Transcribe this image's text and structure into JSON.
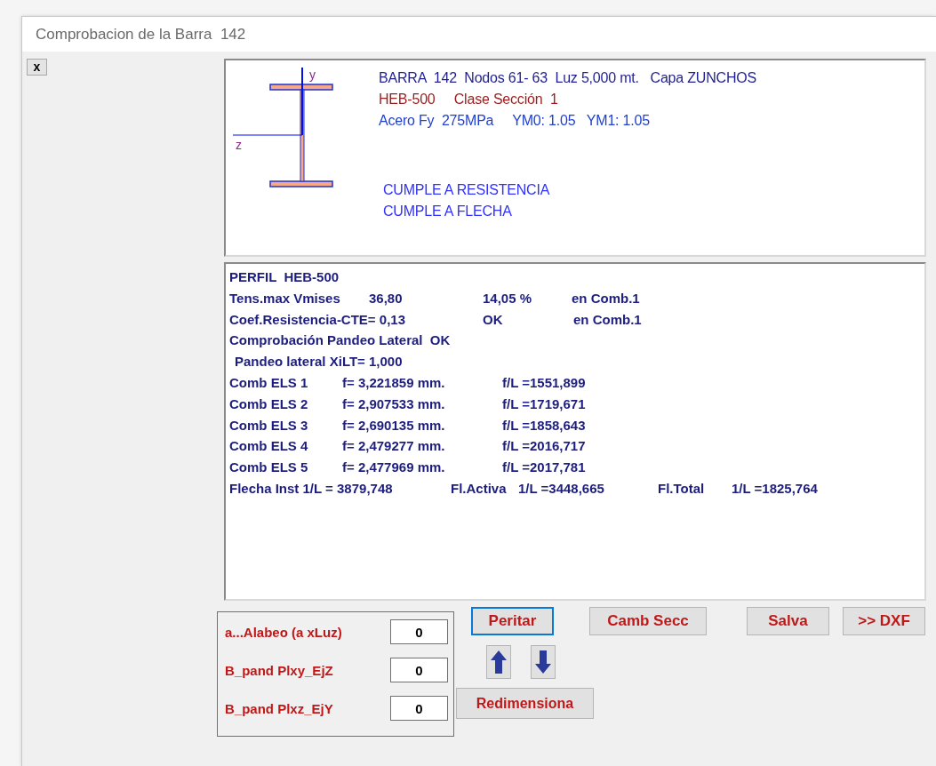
{
  "window": {
    "title": "Comprobacion de la Barra  142"
  },
  "close_button": "x",
  "summary": {
    "axes": {
      "vertical": "y",
      "horizontal": "z"
    },
    "lines": [
      {
        "text": "BARRA  142  Nodos 61- 63  Luz 5,000 mt.   Capa ZUNCHOS",
        "color": "#1f1f8f"
      },
      {
        "text": "HEB-500     Clase Sección  1",
        "color": "#9b1c1c"
      },
      {
        "text": "Acero Fy  275MPa     YM0: 1.05   YM1: 1.05",
        "color": "#1f3fd0"
      }
    ],
    "verdicts": [
      "CUMPLE A RESISTENCIA",
      "CUMPLE A FLECHA"
    ]
  },
  "report": {
    "lines": [
      {
        "kind": "single",
        "parts": [
          "PERFIL  HEB-500"
        ]
      },
      {
        "kind": "stress",
        "parts": [
          "Tens.max Vmises",
          "36,80",
          "14,05 %",
          "en Comb.1"
        ]
      },
      {
        "kind": "coef",
        "parts": [
          "Coef.Resistencia-CTE= 0,13",
          "OK",
          "en Comb.1"
        ]
      },
      {
        "kind": "single",
        "parts": [
          "Comprobación Pandeo Lateral  OK"
        ]
      },
      {
        "kind": "indent",
        "parts": [
          "Pandeo lateral XiLT= 1,000"
        ]
      },
      {
        "kind": "els",
        "parts": [
          "Comb ELS 1",
          "f= 3,221859 mm.",
          "f/L =1551,899"
        ]
      },
      {
        "kind": "els",
        "parts": [
          "Comb ELS 2",
          "f= 2,907533 mm.",
          "f/L =1719,671"
        ]
      },
      {
        "kind": "els",
        "parts": [
          "Comb ELS 3",
          "f= 2,690135 mm.",
          "f/L =1858,643"
        ]
      },
      {
        "kind": "els",
        "parts": [
          "Comb ELS 4",
          "f= 2,479277 mm.",
          "f/L =2016,717"
        ]
      },
      {
        "kind": "els",
        "parts": [
          "Comb ELS 5",
          "f= 2,477969 mm.",
          "f/L =2017,781"
        ]
      },
      {
        "kind": "total",
        "parts": [
          "Flecha Inst 1/L = 3879,748",
          "Fl.Activa",
          "1/L =3448,665",
          "Fl.Total",
          "1/L =1825,764"
        ]
      }
    ]
  },
  "parameters": [
    {
      "label": "a...Alabeo (a xLuz)",
      "value": "0"
    },
    {
      "label": "B_pand Plxy_EjZ",
      "value": "0"
    },
    {
      "label": "B_pand Plxz_EjY",
      "value": "0"
    }
  ],
  "action_buttons": [
    {
      "label": "Peritar",
      "focused": true
    },
    {
      "label": "Camb Secc",
      "focused": false
    },
    {
      "label": "Salva",
      "focused": false
    },
    {
      "label": ">> DXF",
      "focused": false
    }
  ],
  "resize_button": {
    "label": "Redimensiona"
  }
}
